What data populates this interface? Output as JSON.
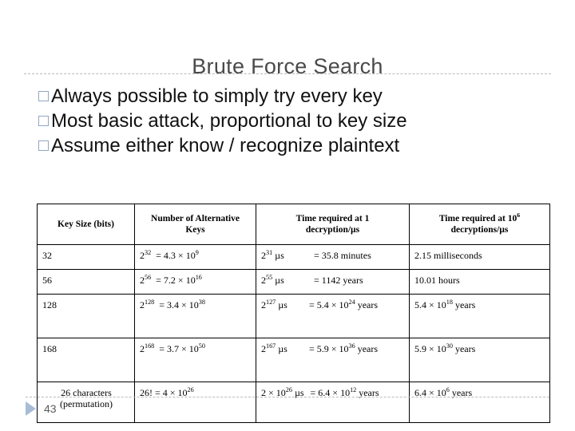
{
  "slide": {
    "title": "Brute Force Search",
    "number": "43",
    "footer_icon": "triangle-right-icon",
    "bullet_icon": "hollow-square-bullet-icon",
    "accent_color": "#93a6c4",
    "title_color": "#4a4a4a",
    "divider_color": "#b9b9b9"
  },
  "bullets": [
    {
      "marker": "□",
      "text": "Always possible to simply try every key"
    },
    {
      "marker": "□",
      "text": "Most basic attack, proportional to key size"
    },
    {
      "marker": "□",
      "text": "Assume either know / recognize plaintext"
    }
  ],
  "table": {
    "headers": [
      "Key Size (bits)",
      "Number of Alternative Keys",
      "Time required at 1 decryption/µs",
      "Time required at 10⁶ decryptions/µs"
    ],
    "headers_html": [
      "Key Size (bits)",
      "Number of Alternative<br>Keys",
      "Time required at 1<br>decryption/µs",
      "Time required at 10<sup>6</sup><br>decryptions/µs"
    ],
    "rows": [
      {
        "key_size": "32",
        "num_keys": "2<sup>32</sup> &nbsp;= 4.3 × 10<sup>9</sup>",
        "time_1_left": "2<sup>31</sup> µs",
        "time_1_right": "= 35.8 minutes",
        "time_106": "2.15 milliseconds"
      },
      {
        "key_size": "56",
        "num_keys": "2<sup>56</sup> &nbsp;= 7.2 × 10<sup>16</sup>",
        "time_1_left": "2<sup>55</sup> µs",
        "time_1_right": "= 1142 years",
        "time_106": "10.01 hours"
      },
      {
        "key_size": "128",
        "num_keys": "2<sup>128</sup> &nbsp;= 3.4 × 10<sup>38</sup>",
        "time_1_left": "2<sup>127</sup> µs",
        "time_1_right": "= 5.4 × 10<sup>24</sup> years",
        "time_106": "5.4 × 10<sup>18</sup> years"
      },
      {
        "key_size": "168",
        "num_keys": "2<sup>168</sup> &nbsp;= 3.7 × 10<sup>50</sup>",
        "time_1_left": "2<sup>167</sup> µs",
        "time_1_right": "= 5.9 × 10<sup>36</sup> years",
        "time_106": "5.9 × 10<sup>30</sup> years"
      },
      {
        "key_size": "26 characters (permutation)",
        "key_size_html": "26 characters<br>(permutation)",
        "num_keys": "26! = 4 × 10<sup>26</sup>",
        "time_1_left": "2 × 10<sup>26</sup> µs",
        "time_1_right": "= 6.4 × 10<sup>12</sup> years",
        "time_106": "6.4 × 10<sup>6</sup> years"
      }
    ]
  }
}
